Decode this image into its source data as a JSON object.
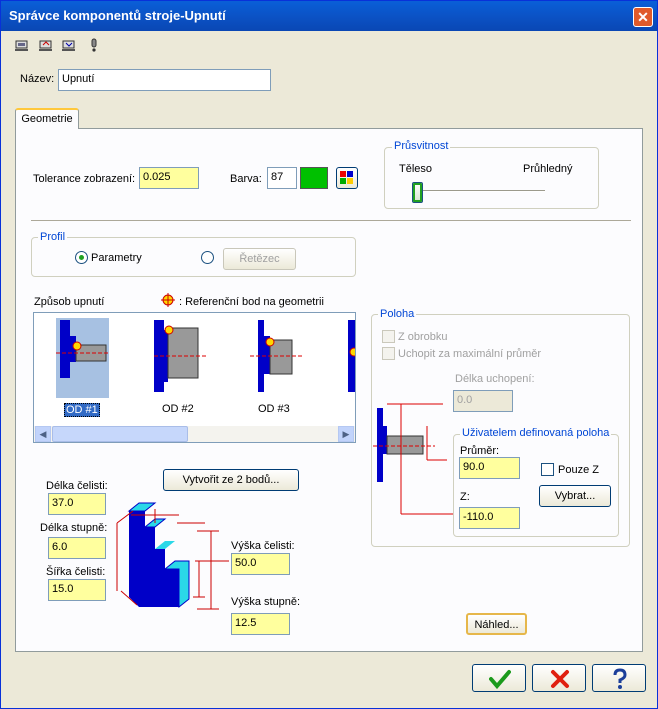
{
  "window": {
    "title": "Správce komponentů stroje-Upnutí"
  },
  "toolbar": {
    "icons": [
      "save-icon",
      "open-icon",
      "export-icon",
      "info-icon"
    ]
  },
  "name": {
    "label": "Název:",
    "value": "Upnutí"
  },
  "tabs": [
    {
      "label": "Geometrie"
    }
  ],
  "display": {
    "tolerance_label": "Tolerance zobrazení:",
    "tolerance_value": "0.025",
    "color_label": "Barva:",
    "color_value": "87",
    "color_swatch": "#00c000"
  },
  "transparency": {
    "title": "Průsvitnost",
    "left_label": "Těleso",
    "right_label": "Průhledný",
    "level": 0
  },
  "profile": {
    "title": "Profil",
    "option1": "Parametry",
    "option2_button": "Řetězec",
    "selected": "Parametry"
  },
  "clamping": {
    "method_label": "Způsob upnutí",
    "ref_point_note": ": Referenční bod na geometrii",
    "items": [
      "OD #1",
      "OD #2",
      "OD #3"
    ],
    "selected": "OD #1"
  },
  "position": {
    "title": "Poloha",
    "from_stock_label": "Z obrobku",
    "grip_max_label": "Uchopit za maximální průměr",
    "grip_length_label": "Délka uchopení:",
    "grip_length_value": "0.0",
    "user_defined_title": "Uživatelem definovaná poloha",
    "diameter_label": "Průměr:",
    "diameter_value": "90.0",
    "only_z_label": "Pouze Z",
    "z_label": "Z:",
    "z_value": "-110.0",
    "select_button": "Vybrat..."
  },
  "dimensions": {
    "create_button": "Vytvořit ze 2 bodů...",
    "jaw_length_label": "Délka čelisti:",
    "jaw_length_value": "37.0",
    "step_length_label": "Délka stupně:",
    "step_length_value": "6.0",
    "jaw_width_label": "Šířka čelisti:",
    "jaw_width_value": "15.0",
    "jaw_height_label": "Výška čelisti:",
    "jaw_height_value": "50.0",
    "step_height_label": "Výška stupně:",
    "step_height_value": "12.5"
  },
  "preview_button": "Náhled...",
  "footer": {
    "ok_icon": "checkmark-icon",
    "cancel_icon": "x-icon",
    "help_icon": "question-icon"
  }
}
